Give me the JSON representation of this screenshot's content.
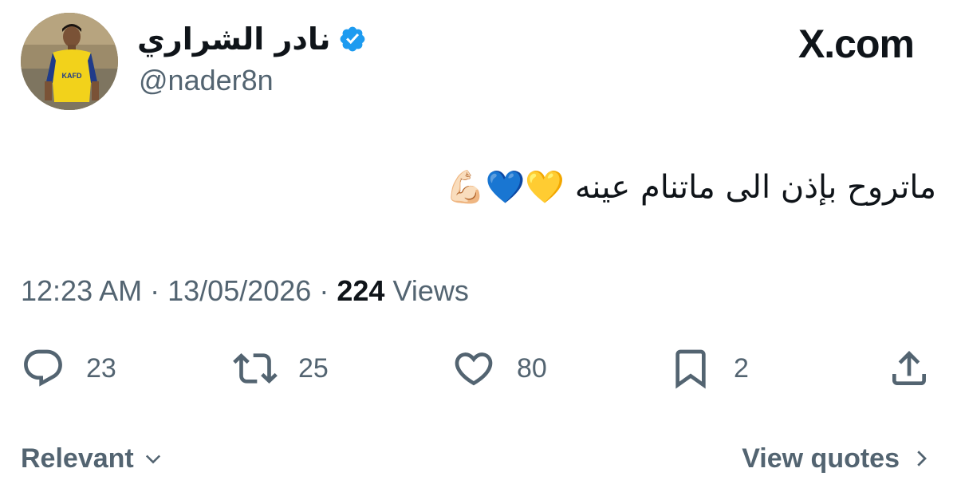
{
  "author": {
    "display_name": "نادر الشراري",
    "handle": "@nader8n",
    "verified": true,
    "verified_color": "#1d9bf0",
    "jersey_text": "KAFD"
  },
  "brand": "X.com",
  "tweet": {
    "text": "ماتروح بإذن الى ماتنام عينه",
    "emojis": [
      "💛",
      "💙",
      "💪🏻"
    ]
  },
  "meta": {
    "time": "12:23 AM",
    "separator": "·",
    "date": "13/05/2026",
    "views_count": "224",
    "views_label": "Views"
  },
  "actions": {
    "replies": "23",
    "reposts": "25",
    "likes": "80",
    "bookmarks": "2"
  },
  "footer": {
    "sort_label": "Relevant",
    "quotes_label": "View quotes"
  },
  "colors": {
    "text_primary": "#0f1419",
    "text_secondary": "#536471",
    "jersey_yellow": "#f2d21b"
  }
}
